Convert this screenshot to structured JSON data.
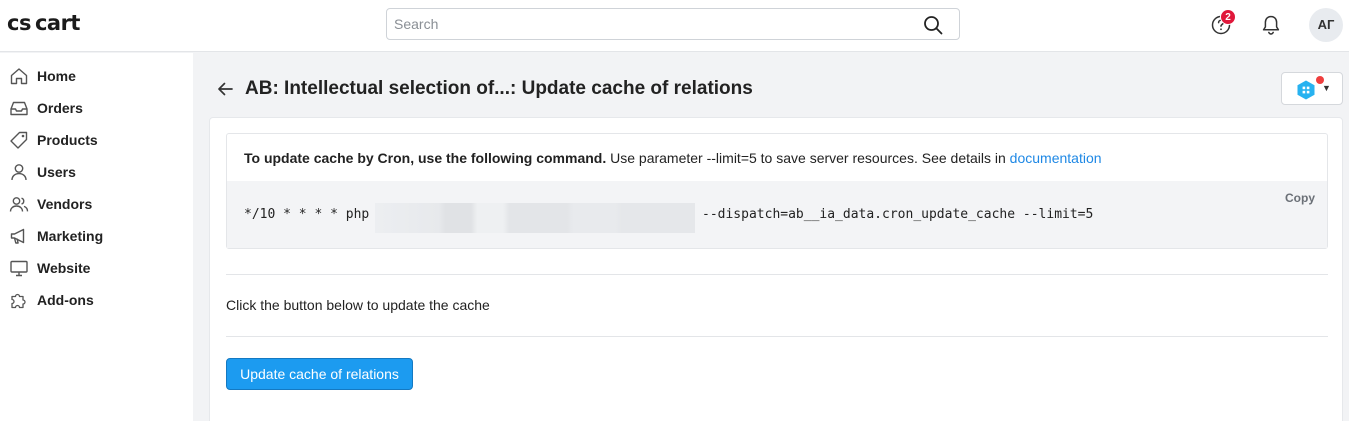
{
  "app": {
    "logo_left": "cs",
    "logo_right": "cart"
  },
  "search": {
    "placeholder": "Search",
    "value": ""
  },
  "header": {
    "notifications_count": "2",
    "avatar_initials": "АГ"
  },
  "sidebar": {
    "items": [
      {
        "label": "Home",
        "icon": "home-icon"
      },
      {
        "label": "Orders",
        "icon": "inbox-icon"
      },
      {
        "label": "Products",
        "icon": "tag-icon"
      },
      {
        "label": "Users",
        "icon": "user-icon"
      },
      {
        "label": "Vendors",
        "icon": "users-icon"
      },
      {
        "label": "Marketing",
        "icon": "megaphone-icon"
      },
      {
        "label": "Website",
        "icon": "monitor-icon"
      },
      {
        "label": "Add-ons",
        "icon": "puzzle-icon"
      }
    ]
  },
  "page": {
    "title": "AB: Intellectual selection of...: Update cache of relations"
  },
  "cron": {
    "intro_bold": "To update cache by Cron, use the following command.",
    "intro_rest": " Use parameter --limit=5 to save server resources. See details in ",
    "doc_link": "documentation",
    "copy_label": "Copy",
    "command_prefix": "*/10 * * * * php",
    "command_suffix": "--dispatch=ab__ia_data.cron_update_cache --limit=5"
  },
  "update": {
    "hint": "Click the button below to update the cache",
    "button_label": "Update cache of relations"
  },
  "colors": {
    "accent": "#1c9bf0",
    "link": "#1e88e5",
    "badge": "#e0183b"
  }
}
